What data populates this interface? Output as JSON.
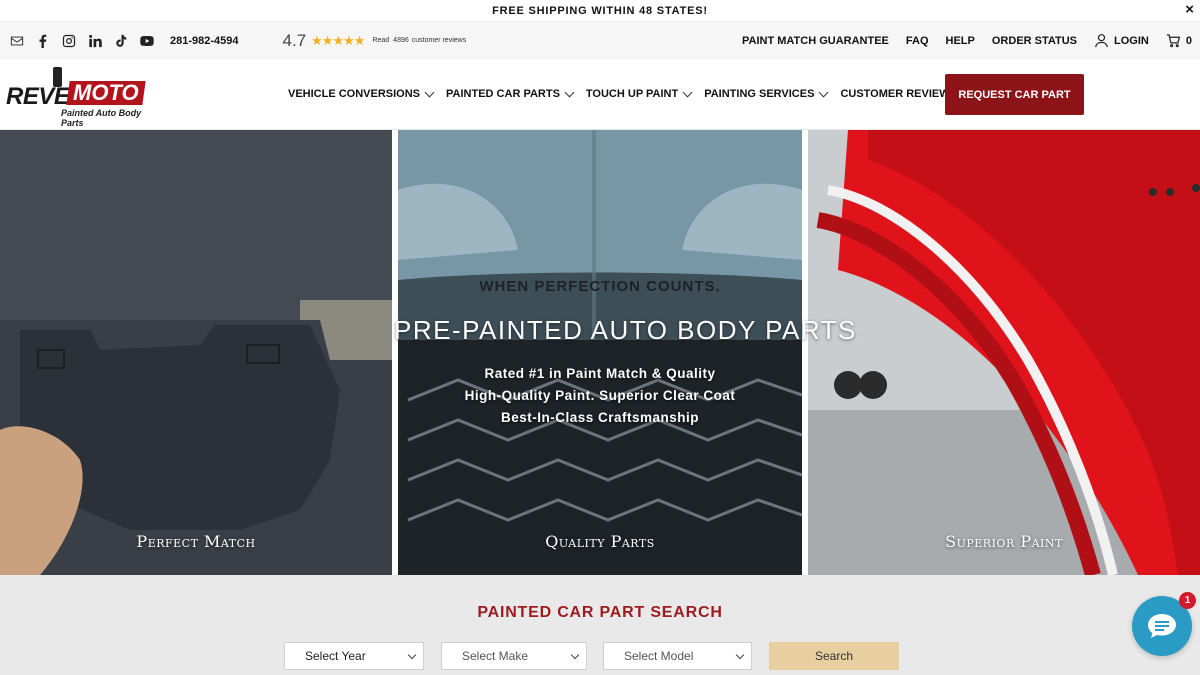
{
  "announcement": {
    "text": "FREE SHIPPING WITHIN 48 STATES!",
    "close": "×"
  },
  "utility": {
    "social_icons": [
      "mail-icon",
      "facebook-icon",
      "instagram-icon",
      "linkedin-icon",
      "tiktok-icon",
      "youtube-icon"
    ],
    "phone": "281-982-4594",
    "rating": {
      "score": "4.7",
      "stars": "★★★★★",
      "read": "Read",
      "count": "4896",
      "label": "customer reviews"
    },
    "links": [
      "PAINT MATCH GUARANTEE",
      "FAQ",
      "HELP",
      "ORDER STATUS"
    ],
    "login": "LOGIN",
    "cart_count": "0"
  },
  "header": {
    "logo": {
      "reve": "REVE",
      "moto": "MOTO",
      "tagline": "Painted Auto Body Parts"
    },
    "nav": [
      {
        "label": "VEHICLE CONVERSIONS",
        "dropdown": true
      },
      {
        "label": "PAINTED CAR PARTS",
        "dropdown": true
      },
      {
        "label": "TOUCH UP PAINT",
        "dropdown": true
      },
      {
        "label": "PAINTING SERVICES",
        "dropdown": true
      },
      {
        "label": "CUSTOMER REVIEWS",
        "dropdown": false
      }
    ],
    "cta": "REQUEST CAR PART"
  },
  "hero": {
    "eyebrow": "WHEN PERFECTION COUNTS.",
    "title": "PRE-PAINTED AUTO BODY PARTS",
    "lines": [
      "Rated #1 in Paint Match & Quality",
      "High-Quality Paint. Superior Clear Coat",
      "Best-In-Class Craftsmanship"
    ],
    "captions": [
      "Perfect Match",
      "Quality Parts",
      "Superior Paint"
    ]
  },
  "search": {
    "title": "PAINTED CAR PART SEARCH",
    "year": "Select Year",
    "make": "Select Make",
    "model": "Select Model",
    "button": "Search"
  },
  "chat": {
    "badge": "1"
  },
  "colors": {
    "brand_red": "#8c1317",
    "title_red": "#9d1a1f",
    "star": "#f2b01e",
    "search_button": "#e8cfa0",
    "chat": "#2a9bc4"
  }
}
